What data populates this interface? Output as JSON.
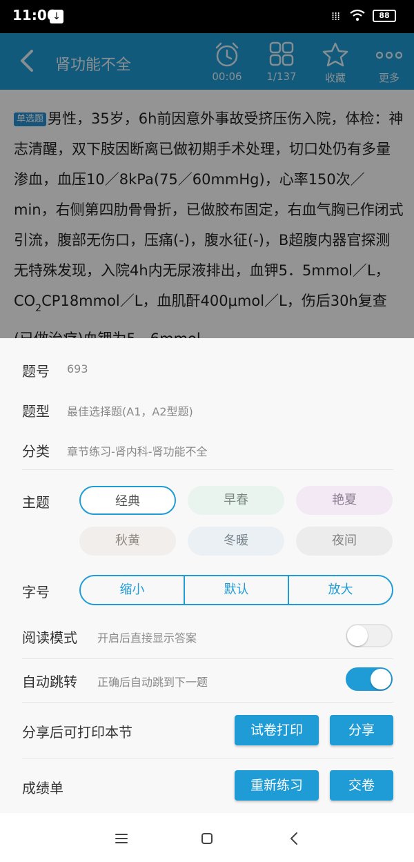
{
  "status": {
    "time": "11:06",
    "battery": "88"
  },
  "header": {
    "title": "肾功能不全",
    "timer_label": "00:06",
    "progress_label": "1/137",
    "favorite_label": "收藏",
    "more_label": "更多"
  },
  "question": {
    "type_badge": "单选题",
    "text_before_sub": "男性，35岁，6h前因意外事故受挤压伤入院，体检：神志清醒，双下肢因断离已做初期手术处理，切口处仍有多量渗血，血压10／8kPa(75／60mmHg)，心率150次／min，右侧第四肋骨骨折，已做胶布固定，右血气胸已作闭式引流，腹部无伤口，压痛(-)，腹水征(-)，B超腹内器官探测无特殊发现，入院4h内无尿液排出，血钾5．5mmol／L，CO",
    "sub": "2",
    "text_after_sub": "CP18mmol／L，血肌酐400μmol／L，伤后30h复查(已做治疗)血钾为5．6mmol"
  },
  "sheet": {
    "question_no_label": "题号",
    "question_no_value": "693",
    "question_type_label": "题型",
    "question_type_value": "最佳选择题(A1，A2型题)",
    "category_label": "分类",
    "category_value": "章节练习-肾内科-肾功能不全",
    "theme_label": "主题",
    "themes": [
      "经典",
      "早春",
      "艳夏",
      "秋黄",
      "冬暖",
      "夜间"
    ],
    "font_label": "字号",
    "font_options": [
      "缩小",
      "默认",
      "放大"
    ],
    "reading_mode_label": "阅读模式",
    "reading_mode_desc": "开启后直接显示答案",
    "auto_jump_label": "自动跳转",
    "auto_jump_desc": "正确后自动跳到下一题",
    "share_label": "分享后可打印本节",
    "print_button": "试卷打印",
    "share_button": "分享",
    "score_label": "成绩单",
    "redo_button": "重新练习",
    "submit_button": "交卷"
  },
  "colors": {
    "accent": "#1f9bd6"
  }
}
